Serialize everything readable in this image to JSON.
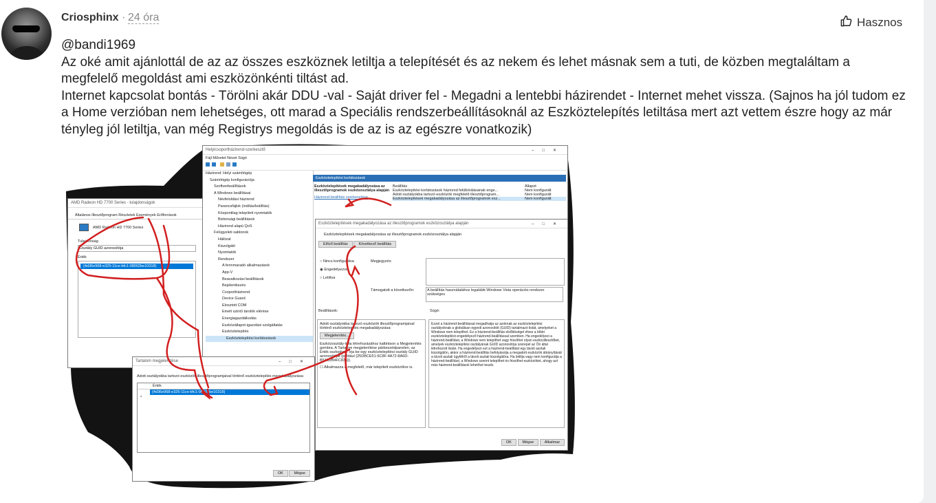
{
  "post": {
    "author": "Criosphinx",
    "separator": "·",
    "time": "24 óra",
    "useful_label": "Hasznos",
    "mention": "@bandi1969",
    "paragraphs": [
      "Az oké amit ajánlottál de az az összes eszköznek letiltja a telepítését és az nekem és lehet másnak sem a tuti, de közben megtaláltam a megfelelő megoldást ami eszközönkénti tiltást ad.",
      "Internet kapcsolat bontás - Törölni akár DDU -val - Saját driver fel - Megadni a lentebbi házirendet - Internet mehet vissza. (Sajnos ha jól tudom ez a Home verzióban nem lehetséges, ott marad a Speciális rendszerbeállításoknál az Eszköztelepítés letiltása mert azt vettem észre hogy az már tényleg jól letiltja, van még Registrys megoldás is de az is az egészre vonatkozik)"
    ]
  },
  "screenshot": {
    "props_title": "AMD Radeon HD 7700 Series - tulajdonságok",
    "props_tabs": "Általános   Illesztőprogram   Részletek   Események   Erőforrások",
    "props_device": "AMD Radeon HD 7700 Series",
    "props_property_label": "Tulajdonság",
    "props_property_value": "Osztály GUID azonosítója",
    "props_value_label": "Érték",
    "props_guid": "{4d36e968-e325-11ce-bfc1-08002be10318}",
    "gpedit_title": "Helyicsoportházirend-szerkesztő",
    "gpedit_menu": "Fájl   Művelet   Nézet   Súgó",
    "tree": [
      "Házirend: Helyi számítógép",
      "Számítógép konfigurációja",
      "Szoftverbeállítások",
      "A Windows beállításai",
      "Névfeloldási házirend",
      "Parancsfájlok (indítás/leállítás)",
      "Központilag telepített nyomtatók",
      "Biztonsági beállítások",
      "Házirend alapú QoS",
      "Felügyeleti sablonok",
      "Hálózat",
      "Kiszolgáló",
      "Nyomtatók",
      "Rendszer",
      "A fennmaradó alkalmazások",
      "App-V",
      "Beavatkozási beállítások",
      "Bejelentkezés",
      "Csoportházirend",
      "Device Guard",
      "Elosztott COM",
      "Emelt szintű tárolók elérése",
      "Energiagazdálkodás",
      "Eszközállapot-igazolási szolgáltatás",
      "Eszköztelepítés",
      "Eszköztelepítési korlátozások"
    ],
    "right_header": "Eszköztelepítési korlátozások",
    "right_desc": "Eszköztelepítések megakadályozása az illesztőprogramok eszközosztálya alapján",
    "right_link": "Házirend-beállítás szerkesztése",
    "list_col1": "Beállítás",
    "list_col2": "Állapot",
    "list_rows": [
      {
        "name": "Eszköztelepítési korlátozások házirend felülbírálásának enge...",
        "state": "Nem konfigurált"
      },
      {
        "name": "Adott osztályokba tartozó eszközök megfelelő illesztőprogram...",
        "state": "Nem konfigurált"
      },
      {
        "name": "Eszköztelepítések megakadályozása az illesztőprogramok esz...",
        "state": "Nem konfigurált"
      }
    ],
    "policy_title": "Eszköztelepítések megakadályozása az illesztőprogramok eszközosztálya alapján",
    "policy_name": "Eszköztelepítések megakadályozása az illesztőprogramok eszközosztálya alapján",
    "prev_btn": "Előző beállítás",
    "next_btn": "Következő beállítás",
    "radio_nc": "Nincs konfigurálva",
    "radio_en": "Engedélyezve",
    "radio_dis": "Letiltva",
    "comment_label": "Megjegyzés:",
    "supported_label": "Támogatott a következőn:",
    "supported_value": "A beállítás használatához legalább Windows Vista operációs rendszer szükséges",
    "options_label": "Beállítások:",
    "help_label": "Súgó:",
    "options_text": "Adott osztályokba tartozó eszközök illesztőprogramjaival történő eszköztelepítés megakadályozása:",
    "show_btn": "Megjelenítés...",
    "options_help": "Eszközosztály-lista létrehozásához kattintson a Megjelenítés gombra. A Tartalom megjelenítése párbeszédpanelen, az Érték oszlopban: írja be egy eszköztelepítési osztály GUID azonosítóját (például {25DBCE51-6C8F-4A72-8A6D-B54C2B4FC835}).",
    "also_apply": "Alkalmazza a megfelelő, már telepített eszközökre is.",
    "help_text": "Ezzel a házirend-beállítással megadhatja az azoknak az eszköztelepítési osztályoknak a globálisan egyedi azonosítóit (GUID) tartalmazó listát, amelyeket a Windows nem telepíthet. Ez a házirend-beállítás elsőbbséget élvez a többi eszköztelepítést engedélyező házirend-beállítással szemben. Ha engedélyezi a házirend-beállítást, a Windows nem telepíthet vagy frissíthet olyan eszközillesztőket, amelyek eszköztelepítési osztályának GUID azonosítója szerepel az Ön által létrehozott listán. Ha engedélyezi ezt a házirend-beállítást egy távoli asztali kiszolgálón, akkor a házirend-beállítás befolyásolja a megadott eszközök átirányítását a távoli asztali ügyfélről a távoli asztali kiszolgálóra. Ha letiltja vagy nem konfigurálja a házirend-beállítást, a Windows szerint telepíthet és frissíthet eszközöket, ahogy azt más házirend-beállítások lehetővé teszik.",
    "ok": "OK",
    "cancel": "Mégse",
    "apply": "Alkalmaz",
    "content_title": "Tartalom megjelenítése",
    "content_desc": "Adott osztályokba tartozó eszközök illesztőprogramjaival történő eszköztelepítés megakadályozása:",
    "content_col": "Érték",
    "content_value": "{4d36e968-e325-11ce-bfc1-08002be10318}",
    "content_ok": "OK",
    "content_cancel": "Mégse"
  },
  "colors": {
    "accent": "#0078d7",
    "arrow": "#d21f1f"
  },
  "icons": [
    "thumbs-up-icon"
  ]
}
